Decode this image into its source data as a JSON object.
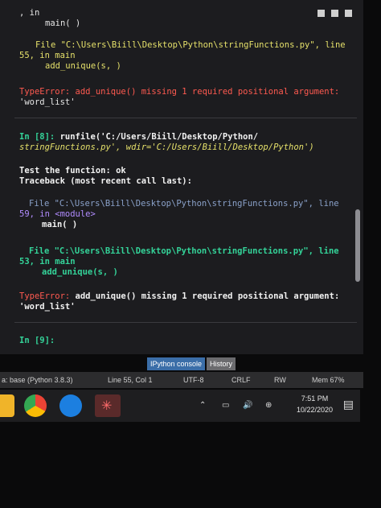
{
  "console": {
    "l1": ", in",
    "l2": "main( )",
    "l3a": "File \"C:\\Users\\Biill\\Desktop\\Python\\stringFunctions.py\", line",
    "l3b": "55, in main",
    "l4": "add_unique(s, )",
    "l5a": "TypeError: add_unique() missing 1 required positional argument:",
    "l5b": "'word_list'",
    "prompt8": "In [8]: ",
    "run_cmd": "runfile('C:/Users/Biill/Desktop/Python/",
    "run_cmd2": "stringFunctions.py', wdir='C:/Users/Biill/Desktop/Python')",
    "test": "Test the function: ok",
    "traceback": "Traceback (most recent call last):",
    "f1a": "File \"C:\\Users\\Biill\\Desktop\\Python\\stringFunctions.py\", line",
    "f1b": "59, in <module>",
    "f1c": "main( )",
    "f2a": "File \"C:\\Users\\Biill\\Desktop\\Python\\stringFunctions.py\", line",
    "f2b": "53, in main",
    "f2c": "add_unique(s, )",
    "err_type": "TypeError:",
    "err_msg": " add_unique() missing 1 required positional argument:",
    "err_msg2": "'word_list'",
    "prompt9": "In [9]:"
  },
  "tabs": {
    "ipython": "IPython console",
    "history": "History"
  },
  "status": {
    "env": "a: base (Python 3.8.3)",
    "position": "Line 55, Col 1",
    "encoding": "UTF-8",
    "eol": "CRLF",
    "perm": "RW",
    "mem": "Mem 67%"
  },
  "clock": {
    "time": "7:51 PM",
    "date": "10/22/2020"
  }
}
